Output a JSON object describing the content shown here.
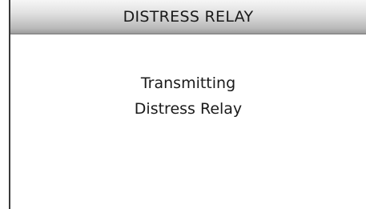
{
  "header": {
    "title": "DISTRESS RELAY"
  },
  "main": {
    "status_line_1": "Transmitting",
    "status_line_2": "Distress Relay"
  }
}
